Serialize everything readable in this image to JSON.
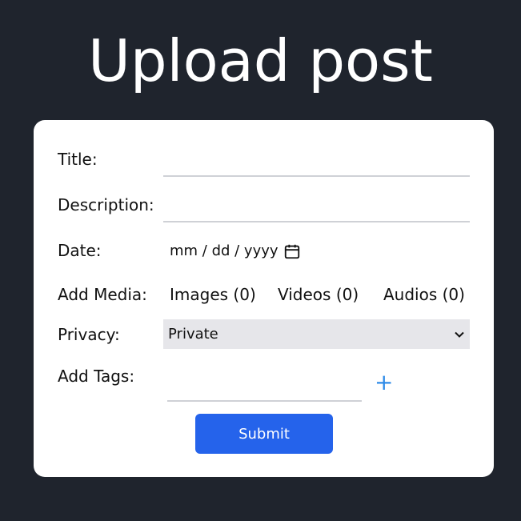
{
  "page": {
    "title": "Upload post"
  },
  "form": {
    "title_label": "Title:",
    "title_value": "",
    "description_label": "Description:",
    "description_value": "",
    "date_label": "Date:",
    "date_placeholder": "mm / dd / yyyy",
    "media_label": "Add Media:",
    "media_items": [
      {
        "label": "Images (0)"
      },
      {
        "label": "Videos (0)"
      },
      {
        "label": "Audios (0)"
      }
    ],
    "privacy_label": "Privacy:",
    "privacy_selected": "Private",
    "tags_label": "Add Tags:",
    "tags_value": "",
    "add_tag_symbol": "+",
    "submit_label": "Submit"
  },
  "colors": {
    "background": "#1f242d",
    "card": "#ffffff",
    "accent": "#2563eb",
    "add_tag": "#2f8be8"
  },
  "icons": {
    "date": "calendar-icon",
    "privacy": "chevron-down-icon",
    "add_tag": "plus-icon"
  }
}
